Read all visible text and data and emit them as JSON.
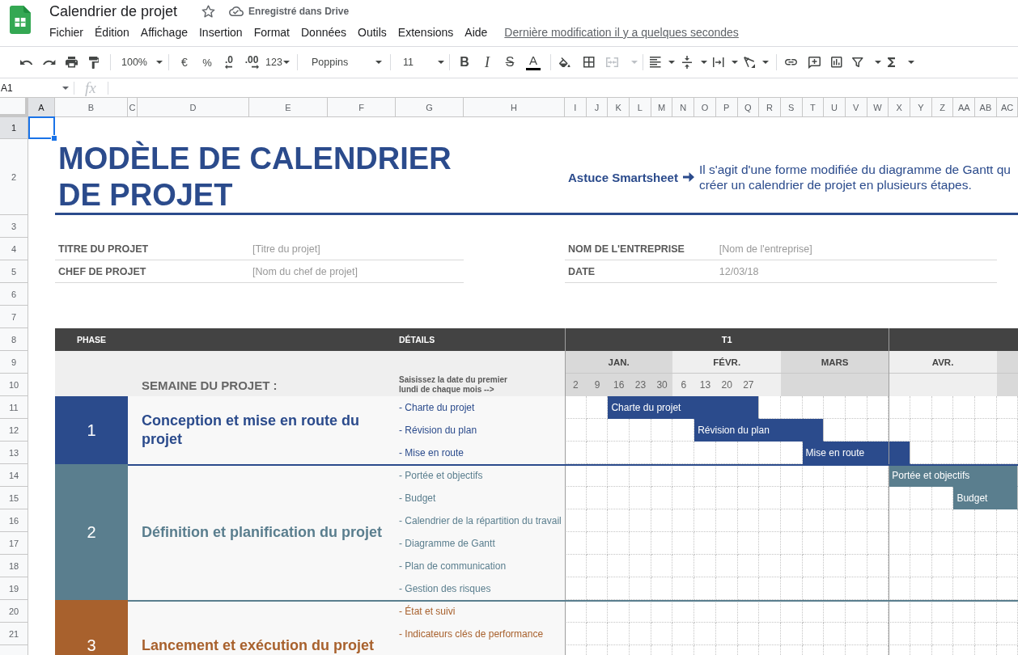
{
  "app": {
    "title": "Calendrier de projet",
    "starred": false,
    "save_status": "Enregistré dans Drive"
  },
  "menu": {
    "items": [
      "Fichier",
      "Édition",
      "Affichage",
      "Insertion",
      "Format",
      "Données",
      "Outils",
      "Extensions",
      "Aide"
    ],
    "last_edit": "Dernière modification il y a quelques secondes"
  },
  "toolbar": {
    "zoom": "100%",
    "currency": "€",
    "percent": "%",
    "decrease_decimals": ".0",
    "increase_decimals": ".00",
    "number_format": "123",
    "font": "Poppins",
    "font_size": "11",
    "bold": "B",
    "italic": "I",
    "strikethrough": "S",
    "text_color": "A",
    "merge_cells": {
      "disabled": true
    }
  },
  "formula_bar": {
    "cell_reference": "A1",
    "function_label": "fx"
  },
  "sheet": {
    "columns": [
      {
        "label": "A",
        "selected": true
      },
      {
        "label": "B",
        "selected": false
      },
      {
        "label": "C",
        "selected": false
      },
      {
        "label": "D",
        "selected": false
      },
      {
        "label": "E",
        "selected": false
      },
      {
        "label": "F",
        "selected": false
      },
      {
        "label": "G",
        "selected": false
      },
      {
        "label": "H",
        "selected": false
      },
      {
        "label": "I",
        "selected": false
      },
      {
        "label": "J",
        "selected": false
      },
      {
        "label": "K",
        "selected": false
      },
      {
        "label": "L",
        "selected": false
      },
      {
        "label": "M",
        "selected": false
      },
      {
        "label": "N",
        "selected": false
      },
      {
        "label": "O",
        "selected": false
      },
      {
        "label": "P",
        "selected": false
      },
      {
        "label": "Q",
        "selected": false
      },
      {
        "label": "R",
        "selected": false
      },
      {
        "label": "S",
        "selected": false
      },
      {
        "label": "T",
        "selected": false
      },
      {
        "label": "U",
        "selected": false
      },
      {
        "label": "V",
        "selected": false
      },
      {
        "label": "W",
        "selected": false
      },
      {
        "label": "X",
        "selected": false
      },
      {
        "label": "Y",
        "selected": false
      },
      {
        "label": "Z",
        "selected": false
      },
      {
        "label": "AA",
        "selected": false
      },
      {
        "label": "AB",
        "selected": false
      },
      {
        "label": "AC",
        "selected": false
      }
    ],
    "rows": [
      {
        "label": "1",
        "selected": true
      },
      {
        "label": "2",
        "selected": false
      },
      {
        "label": "3",
        "selected": false
      },
      {
        "label": "4",
        "selected": false
      },
      {
        "label": "5",
        "selected": false
      },
      {
        "label": "6",
        "selected": false
      },
      {
        "label": "7",
        "selected": false
      },
      {
        "label": "8",
        "selected": false
      },
      {
        "label": "9",
        "selected": false
      },
      {
        "label": "10",
        "selected": false
      },
      {
        "label": "11",
        "selected": false
      },
      {
        "label": "12",
        "selected": false
      },
      {
        "label": "13",
        "selected": false
      },
      {
        "label": "14",
        "selected": false
      },
      {
        "label": "15",
        "selected": false
      },
      {
        "label": "16",
        "selected": false
      },
      {
        "label": "17",
        "selected": false
      },
      {
        "label": "18",
        "selected": false
      },
      {
        "label": "19",
        "selected": false
      },
      {
        "label": "20",
        "selected": false
      },
      {
        "label": "21",
        "selected": false
      }
    ],
    "title": "MODÈLE DE CALENDRIER DE PROJET",
    "tip": {
      "label": "Astuce Smartsheet",
      "lines": [
        "Il s'agit d'une forme modifiée du diagramme de Gantt qu",
        "créer un calendrier de projet en plusieurs étapes."
      ]
    },
    "project_info": {
      "left": [
        {
          "label": "TITRE DU PROJET",
          "value": "[Titre du projet]"
        },
        {
          "label": "CHEF DE PROJET",
          "value": "[Nom du chef de projet]"
        }
      ],
      "right": [
        {
          "label": "NOM DE L'ENTREPRISE",
          "value": "[Nom de l'entreprise]"
        },
        {
          "label": "DATE",
          "value": "12/03/18"
        }
      ]
    },
    "schedule": {
      "phase_heading": "PHASE",
      "details_heading": "DÉTAILS",
      "week_label": "SEMAINE DU PROJET :",
      "instruction": "Saisissez la date du premier lundi de chaque mois -->",
      "quarters": [
        {
          "label": "T1",
          "months": [
            {
              "label": "JAN.",
              "weeks": [
                "2",
                "9",
                "16",
                "23",
                "30"
              ]
            },
            {
              "label": "FÉVR.",
              "weeks": [
                "6",
                "13",
                "20",
                "27"
              ]
            },
            {
              "label": "MARS"
            }
          ]
        },
        {
          "months": [
            {
              "label": "AVR."
            }
          ]
        }
      ],
      "phases": [
        {
          "number": "1",
          "title": "Conception et mise en route du projet",
          "color": "#2b4b8c",
          "tasks": [
            {
              "detail": "- Charte du projet",
              "bar_label": "Charte du projet",
              "timeline": [
                false,
                false,
                true,
                true,
                true,
                true,
                true,
                true,
                true,
                false,
                false,
                false,
                false,
                false,
                false,
                false,
                false,
                false,
                false,
                false,
                false
              ]
            },
            {
              "detail": "- Révision du plan",
              "bar_label": "Révision du plan",
              "timeline": [
                false,
                false,
                false,
                false,
                false,
                false,
                true,
                true,
                true,
                true,
                true,
                true,
                false,
                false,
                false,
                false,
                false,
                false,
                false,
                false,
                false
              ]
            },
            {
              "detail": "- Mise en route",
              "bar_label": "Mise en route",
              "timeline": [
                false,
                false,
                false,
                false,
                false,
                false,
                false,
                false,
                false,
                false,
                false,
                true,
                true,
                true,
                true,
                true,
                false,
                false,
                false,
                false,
                false
              ]
            }
          ]
        },
        {
          "number": "2",
          "title": "Définition et planification du projet",
          "color": "#5a7e8e",
          "tasks": [
            {
              "detail": "- Portée et objectifs",
              "bar_label": "Portée et objectifs",
              "timeline": [
                false,
                false,
                false,
                false,
                false,
                false,
                false,
                false,
                false,
                false,
                false,
                false,
                false,
                false,
                false,
                true,
                true,
                true,
                true,
                true,
                true
              ]
            },
            {
              "detail": "- Budget",
              "bar_label": "Budget",
              "timeline": [
                false,
                false,
                false,
                false,
                false,
                false,
                false,
                false,
                false,
                false,
                false,
                false,
                false,
                false,
                false,
                false,
                false,
                false,
                true,
                true,
                true
              ]
            },
            {
              "detail": "- Calendrier de la répartition du travail"
            },
            {
              "detail": "- Diagramme de Gantt"
            },
            {
              "detail": "- Plan de communication"
            },
            {
              "detail": "- Gestion des risques"
            }
          ]
        },
        {
          "number": "3",
          "title": "Lancement et exécution du projet",
          "color": "#a8612d",
          "tasks": [
            {
              "detail": "- État et suivi"
            },
            {
              "detail": "- Indicateurs clés de performance"
            }
          ]
        }
      ]
    }
  }
}
